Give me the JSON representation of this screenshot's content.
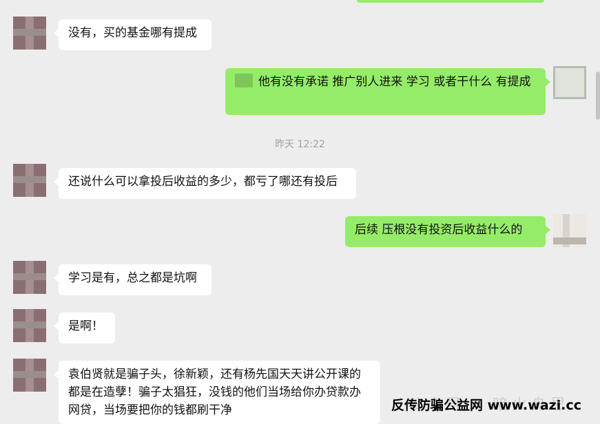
{
  "messages": [
    {
      "side": "in",
      "text": "没有，买的基金哪有提成"
    },
    {
      "side": "out",
      "text": "他有没有承诺  推广别人进来   学习  或者干什么    有提成"
    },
    {
      "side": "in",
      "text": "还说什么可以拿投后收益的多少，都亏了哪还有投后"
    },
    {
      "side": "out",
      "text": "后续   压根没有投资后收益什么的"
    },
    {
      "side": "in",
      "text": "学习是有，总之都是坑啊"
    },
    {
      "side": "in",
      "text": "是啊！"
    },
    {
      "side": "in",
      "text": "袁伯贤就是骗子头，徐新颖，还有杨先国天天讲公开课的都是在造孽！骗子太猖狂，没钱的他们当场给你办贷款办网贷，当场要把你的钱都刷干净"
    }
  ],
  "timestamp": "昨天 12:22",
  "watermark_faint": "公众号 · 暗火舟思",
  "watermark": "反传防骗公益网 www.wazi.cc",
  "colors": {
    "incoming": "#ffffff",
    "outgoing": "#95ec69",
    "background": "#ededed"
  }
}
